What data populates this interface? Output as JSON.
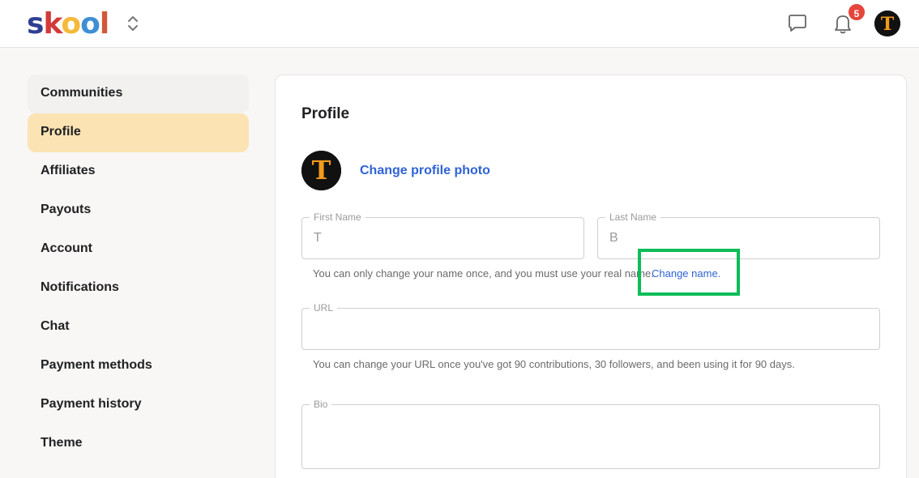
{
  "header": {
    "logo": [
      "s",
      "k",
      "o",
      "o",
      "l"
    ],
    "notification_count": "5",
    "icons": [
      "chevron-up-down-icon",
      "chat-bubble-icon",
      "bell-icon",
      "avatar"
    ],
    "colors": {
      "badge": "#e5453b",
      "logo_blue": "#2e3e92",
      "logo_red": "#d23a3a",
      "logo_yellow": "#f5b93a",
      "logo_lightblue": "#3f8fd6",
      "logo_orange": "#d2583a"
    }
  },
  "sidebar": {
    "items": [
      {
        "label": "Communities",
        "state": "hover"
      },
      {
        "label": "Profile",
        "state": "active"
      },
      {
        "label": "Affiliates",
        "state": ""
      },
      {
        "label": "Payouts",
        "state": ""
      },
      {
        "label": "Account",
        "state": ""
      },
      {
        "label": "Notifications",
        "state": ""
      },
      {
        "label": "Chat",
        "state": ""
      },
      {
        "label": "Payment methods",
        "state": ""
      },
      {
        "label": "Payment history",
        "state": ""
      },
      {
        "label": "Theme",
        "state": ""
      }
    ],
    "active_color": "#fbe3b3"
  },
  "profile": {
    "title": "Profile",
    "change_photo": "Change profile photo",
    "avatar_letter": "T",
    "first_name": {
      "label": "First Name",
      "value": "T"
    },
    "last_name": {
      "label": "Last Name",
      "value": "B"
    },
    "name_help": "You can only change your name once, and you must use your real name.",
    "change_name": "Change name.",
    "url": {
      "label": "URL",
      "value": ""
    },
    "url_help": "You can change your URL once you've got 90 contributions, 30 followers, and been using it for 90 days.",
    "bio": {
      "label": "Bio",
      "value": ""
    },
    "link_color": "#2e63d6",
    "highlight_color": "#0bbd57"
  }
}
